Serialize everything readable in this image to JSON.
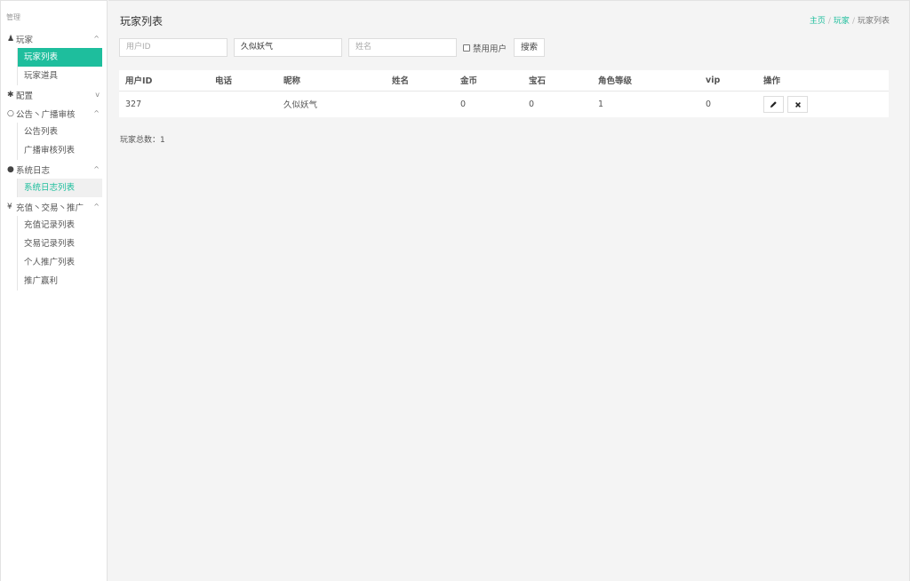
{
  "sidebar": {
    "header": "管理",
    "groups": [
      {
        "label": "玩家",
        "icon": "user-icon",
        "chev": "^",
        "items": [
          "玩家列表",
          "玩家道具"
        ]
      },
      {
        "label": "配置",
        "icon": "gear-icon",
        "chev": "v",
        "items": []
      },
      {
        "label": "公告丶广播审核",
        "icon": "comment-icon",
        "chev": "^",
        "items": [
          "公告列表",
          "广播审核列表"
        ]
      },
      {
        "label": "系统日志",
        "icon": "android-icon",
        "chev": "^",
        "items": [
          "系统日志列表"
        ]
      },
      {
        "label": "充值丶交易丶推广",
        "icon": "yen-icon",
        "chev": "^",
        "items": [
          "充值记录列表",
          "交易记录列表",
          "个人推广列表",
          "推广赢利"
        ]
      }
    ]
  },
  "page": {
    "title": "玩家列表",
    "breadcrumb": {
      "home": "主页",
      "sep": "/",
      "section": "玩家",
      "current": "玩家列表"
    }
  },
  "filters": {
    "user_id_placeholder": "用户ID",
    "nickname_value": "久似妖气",
    "name_placeholder": "姓名",
    "disabled_label": "禁用用户",
    "search_label": "搜索"
  },
  "table": {
    "headers": [
      "用户ID",
      "电话",
      "昵称",
      "姓名",
      "金币",
      "宝石",
      "角色等级",
      "vip",
      "操作"
    ],
    "rows": [
      {
        "user_id": "327",
        "phone": "",
        "nickname": "久似妖气",
        "name": "",
        "gold": "0",
        "gems": "0",
        "level": "1",
        "vip": "0"
      }
    ]
  },
  "footer": {
    "total_text": "玩家总数：1"
  },
  "colors": {
    "accent": "#1ebe9d",
    "bg": "#f4f4f4"
  },
  "icons": {
    "edit": "pencil-icon",
    "delete": "close-icon"
  }
}
